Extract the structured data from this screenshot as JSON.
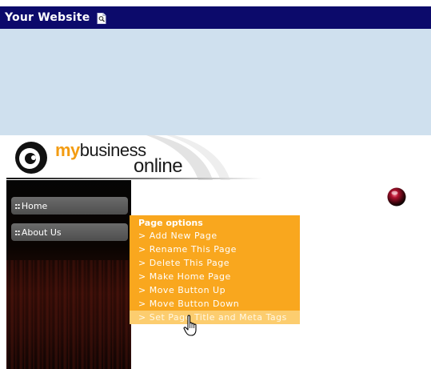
{
  "window": {
    "title": "Your Website",
    "title_icon": "page-preview-icon"
  },
  "logo": {
    "prefix": "my",
    "word1": "business",
    "word2": "online"
  },
  "nav": {
    "items": [
      {
        "label": "Home",
        "icon": "dots-grip-icon"
      },
      {
        "label": "About Us",
        "icon": "dots-grip-icon"
      }
    ]
  },
  "page_options": {
    "heading": "Page options",
    "items": [
      "> Add New Page",
      "> Rename This Page",
      "> Delete This Page",
      "> Make Home Page",
      "> Move Button Up",
      "> Move Button Down",
      "> Set Page Title and Meta Tags"
    ],
    "hovered_index": 6
  },
  "colors": {
    "title_bar": "#0c0a6b",
    "banner": "#cfe0ee",
    "menu_bg": "#f9a71e",
    "menu_hover": "#fccd6f",
    "logo_accent": "#f39c12"
  }
}
